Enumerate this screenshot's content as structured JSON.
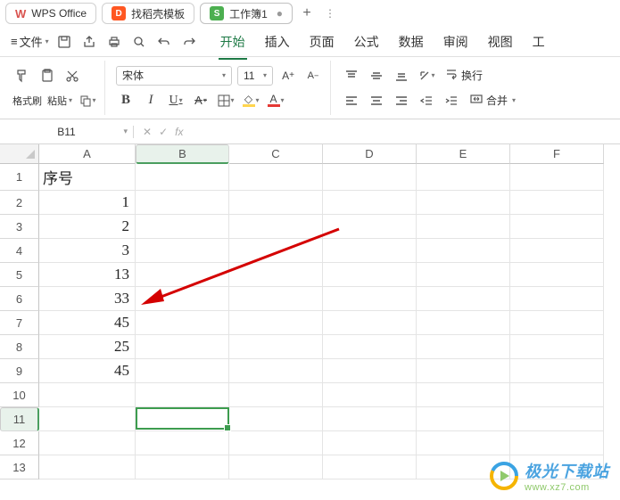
{
  "title_tabs": {
    "t0": "WPS Office",
    "t1": "找稻壳模板",
    "t2": "工作簿1"
  },
  "menu": {
    "file": "文件",
    "tabs": {
      "start": "开始",
      "insert": "插入",
      "page": "页面",
      "formula": "公式",
      "data": "数据",
      "review": "审阅",
      "view": "视图",
      "tools": "工"
    }
  },
  "ribbon": {
    "format_painter": "格式刷",
    "paste": "粘贴",
    "font_name": "宋体",
    "font_size": "11",
    "wrap": "换行",
    "merge": "合并"
  },
  "namebox": "B11",
  "columns": [
    "A",
    "B",
    "C",
    "D",
    "E",
    "F"
  ],
  "rows": [
    "1",
    "2",
    "3",
    "4",
    "5",
    "6",
    "7",
    "8",
    "9",
    "10",
    "11",
    "12",
    "13"
  ],
  "cellsA": {
    "r1": "序号",
    "r2": "1",
    "r3": "2",
    "r4": "3",
    "r5": "13",
    "r6": "33",
    "r7": "45",
    "r8": "25",
    "r9": "45"
  },
  "chart_data": {
    "type": "table",
    "columns": [
      "序号"
    ],
    "values": [
      1,
      2,
      3,
      13,
      33,
      45,
      25,
      45
    ]
  },
  "watermark": {
    "cn": "极光下载站",
    "en": "www.xz7.com"
  }
}
